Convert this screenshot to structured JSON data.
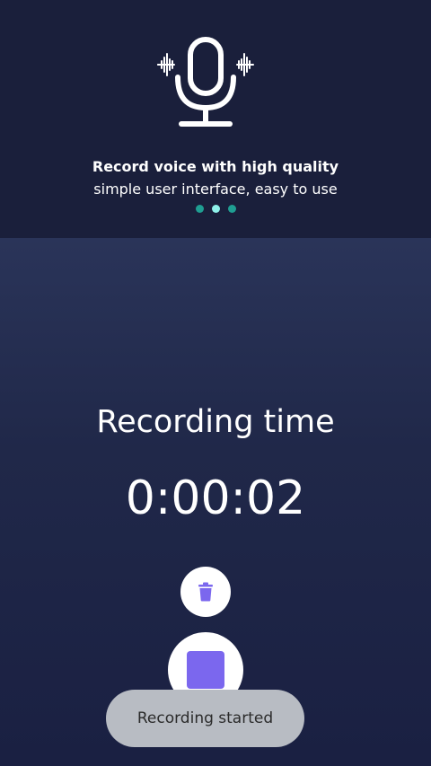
{
  "banner": {
    "title": "Record voice with high quality",
    "subtitle": "simple user interface, easy to use",
    "icon": "microphone-icon",
    "pager": {
      "count": 3,
      "active_index": 1
    }
  },
  "recording": {
    "label": "Recording time",
    "timer": "0:00:02"
  },
  "controls": {
    "delete_icon": "trash-icon",
    "stop_icon": "stop-icon"
  },
  "toast": {
    "message": "Recording started"
  },
  "colors": {
    "banner_bg": "#1a1f3b",
    "accent_purple": "#7b67ee",
    "pager_dot": "#1f9e92",
    "pager_dot_active": "#8ff1ea"
  }
}
